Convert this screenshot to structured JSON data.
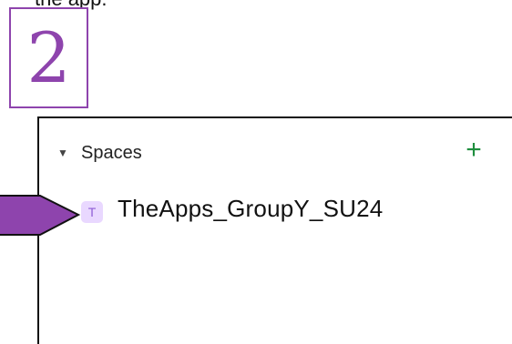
{
  "top_text": "the app.",
  "step": {
    "number": "2",
    "color": "#8E44AD"
  },
  "spaces": {
    "title": "Spaces",
    "add_icon": "plus-icon",
    "caret_icon": "caret-down-icon",
    "items": [
      {
        "initial": "T",
        "name": "TheApps_GroupY_SU24",
        "avatar_bg": "#E9D8FF",
        "avatar_color": "#8E5ED6"
      }
    ]
  },
  "colors": {
    "accent": "#8E44AD",
    "add": "#1E8E3E"
  }
}
